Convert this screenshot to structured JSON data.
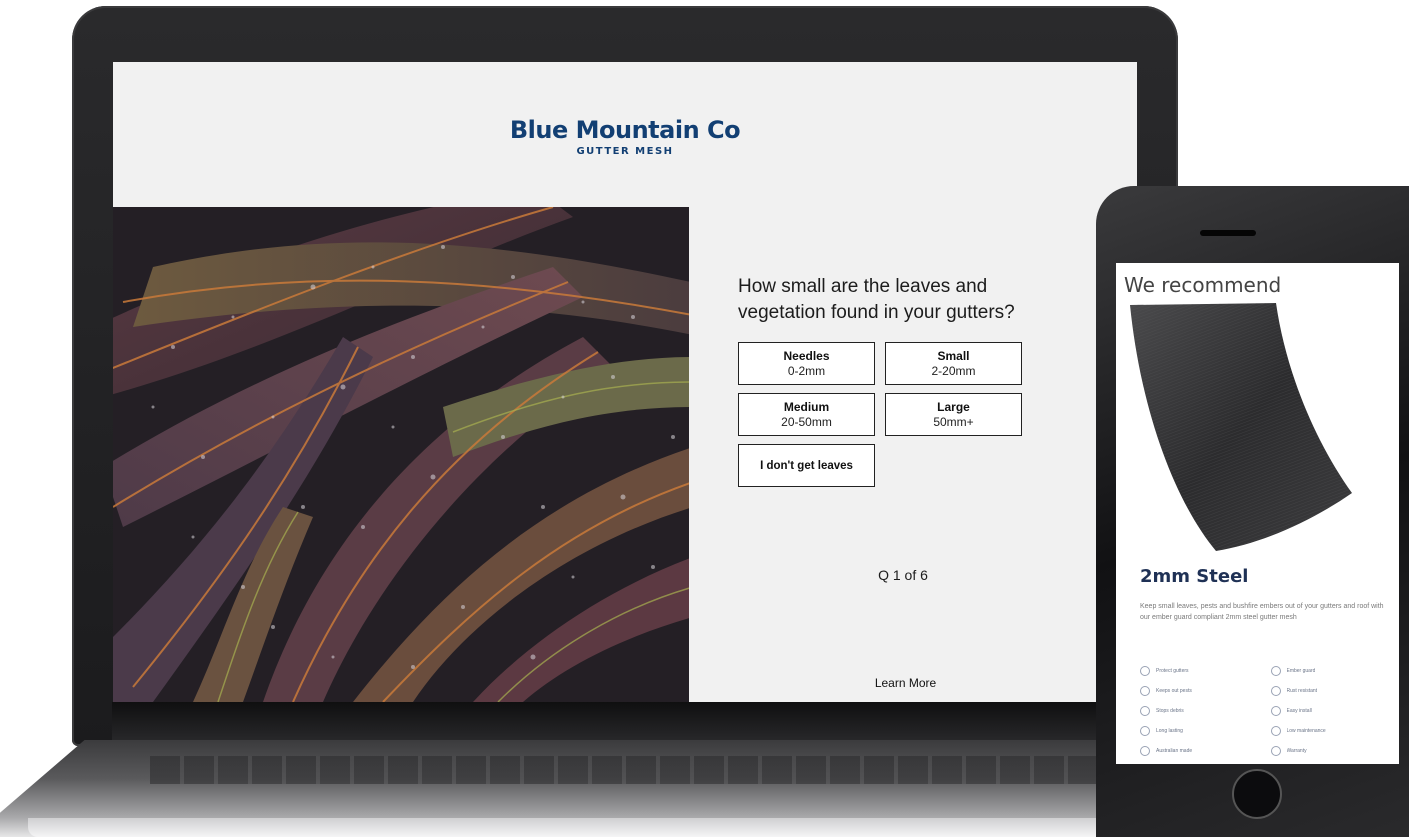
{
  "brand": {
    "name": "Blue Mountain Co",
    "tagline": "GUTTER MESH"
  },
  "quiz": {
    "question": "How small are the leaves and vegetation found in your gutters?",
    "options": [
      {
        "label": "Needles",
        "sub": "0-2mm"
      },
      {
        "label": "Small",
        "sub": "2-20mm"
      },
      {
        "label": "Medium",
        "sub": "20-50mm"
      },
      {
        "label": "Large",
        "sub": "50mm+"
      },
      {
        "label": "I don't get leaves",
        "sub": ""
      }
    ],
    "progress": "Q 1 of 6",
    "learn_more": "Learn More"
  },
  "phone": {
    "title": "We recommend",
    "product_name": "2mm Steel",
    "description": "Keep small leaves, pests and bushfire embers out of your gutters and roof with our ember guard compliant 2mm steel gutter mesh",
    "features": [
      "Protect gutters",
      "Ember guard",
      "Keeps out pests",
      "Rust resistant",
      "Stops debris",
      "Easy install",
      "Long lasting",
      "Low maintenance",
      "Australian made",
      "Warranty"
    ]
  },
  "colors": {
    "brand_blue": "#123f73",
    "page_bg": "#f1f1f1",
    "product_title": "#1f3155"
  },
  "icons": {
    "feature_icon": "circle-outline-icon"
  }
}
